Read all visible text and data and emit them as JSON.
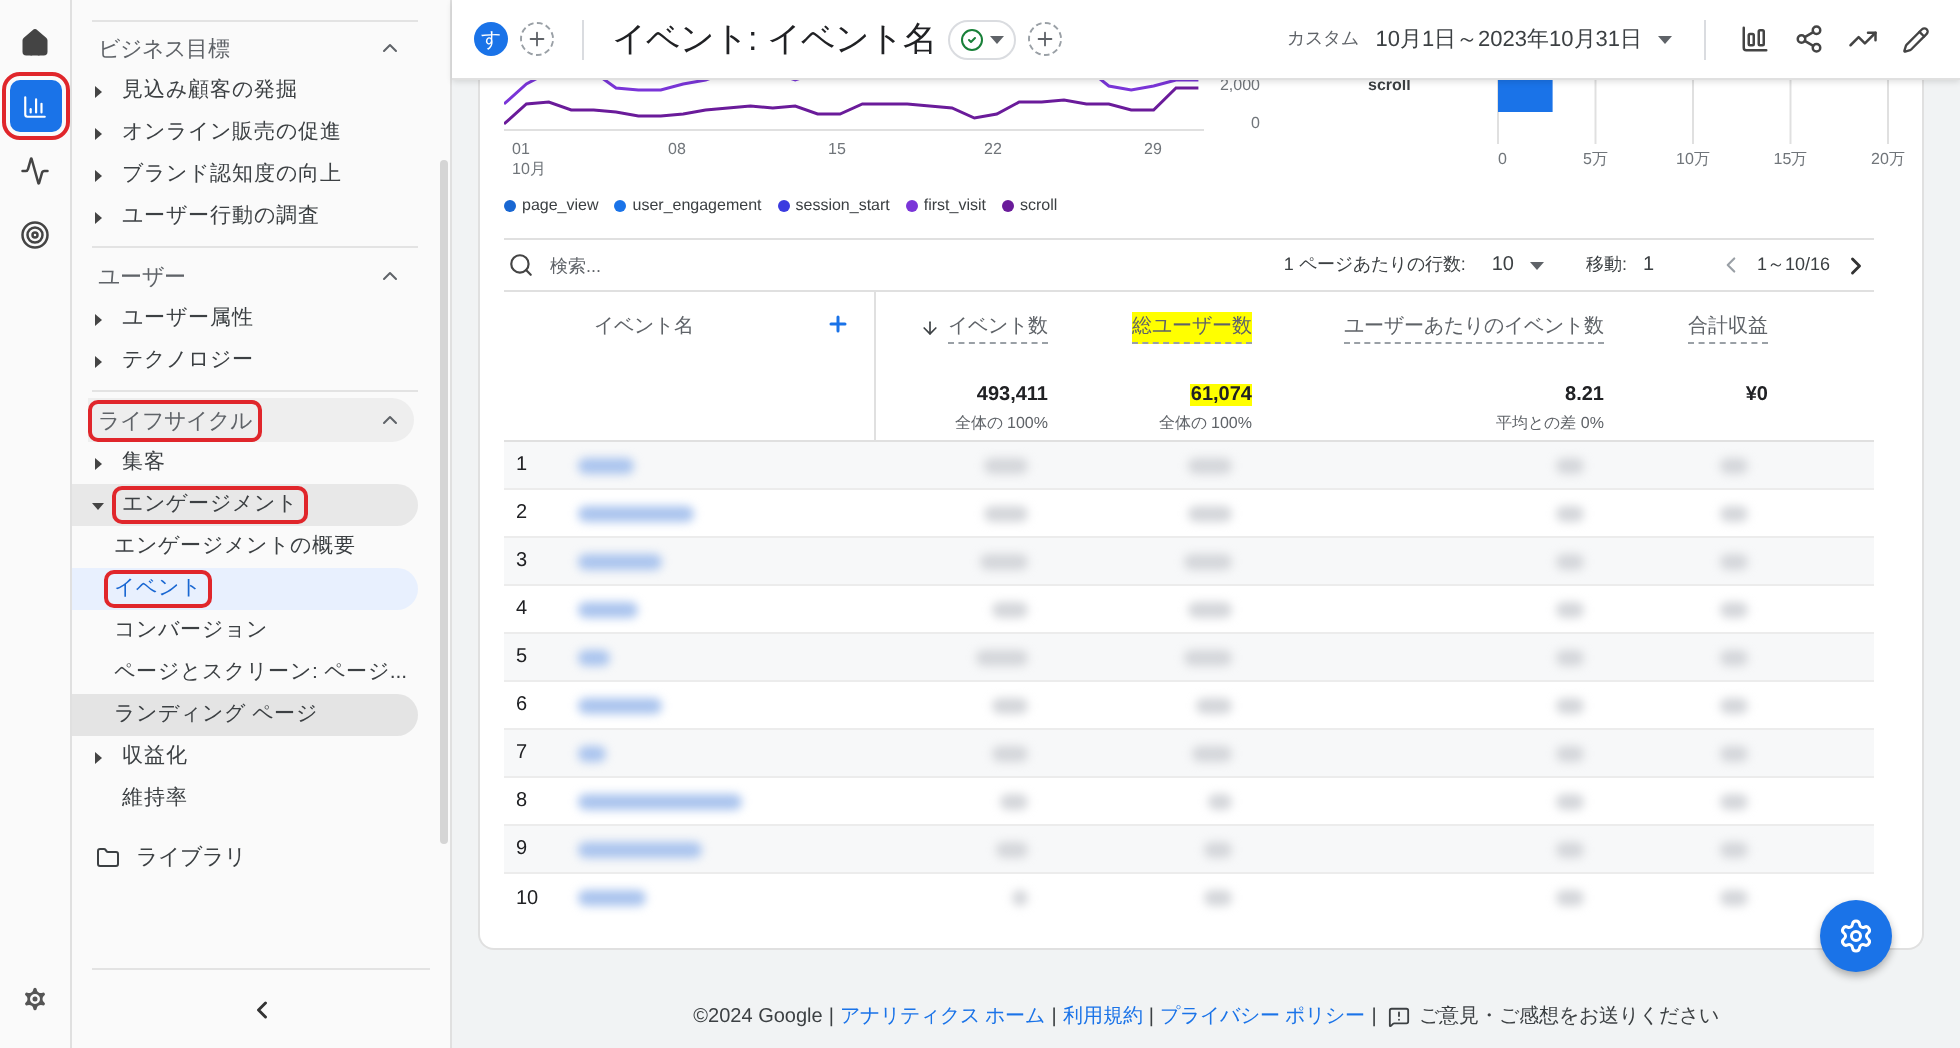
{
  "rail": {
    "items": [
      {
        "kind": "home",
        "selected": false,
        "annotated": false
      },
      {
        "kind": "reports",
        "selected": true,
        "annotated": true
      },
      {
        "kind": "explore",
        "selected": false,
        "annotated": false
      },
      {
        "kind": "advertising",
        "selected": false,
        "annotated": false
      }
    ],
    "settings": {
      "kind": "settings"
    }
  },
  "nav": {
    "sections": [
      {
        "title": "ビジネス目標",
        "expanded": true,
        "annotated": false,
        "hovered": false,
        "items": [
          {
            "label": "見込み顧客の発掘",
            "kind": "group",
            "expanded": false,
            "annotated": false
          },
          {
            "label": "オンライン販売の促進",
            "kind": "group",
            "expanded": false,
            "annotated": false
          },
          {
            "label": "ブランド認知度の向上",
            "kind": "group",
            "expanded": false,
            "annotated": false
          },
          {
            "label": "ユーザー行動の調査",
            "kind": "group",
            "expanded": false,
            "annotated": false
          }
        ]
      },
      {
        "title": "ユーザー",
        "expanded": true,
        "annotated": false,
        "hovered": false,
        "items": [
          {
            "label": "ユーザー属性",
            "kind": "group",
            "expanded": false,
            "annotated": false
          },
          {
            "label": "テクノロジー",
            "kind": "group",
            "expanded": false,
            "annotated": false
          }
        ]
      },
      {
        "title": "ライフサイクル",
        "expanded": true,
        "annotated": true,
        "hovered": true,
        "items": [
          {
            "label": "集客",
            "kind": "group",
            "expanded": false,
            "annotated": false
          },
          {
            "label": "エンゲージメント",
            "kind": "group",
            "expanded": true,
            "annotated": true,
            "children": [
              {
                "label": "エンゲージメントの概要",
                "selected": false,
                "annotated": false,
                "hovered": false
              },
              {
                "label": "イベント",
                "selected": true,
                "annotated": true,
                "hovered": false
              },
              {
                "label": "コンバージョン",
                "selected": false,
                "annotated": false,
                "hovered": false
              },
              {
                "label": "ページとスクリーン: ページ...",
                "selected": false,
                "annotated": false,
                "hovered": false
              },
              {
                "label": "ランディング ページ",
                "selected": false,
                "annotated": false,
                "hovered": true
              }
            ]
          },
          {
            "label": "収益化",
            "kind": "group",
            "expanded": false,
            "annotated": false
          },
          {
            "label": "維持率",
            "kind": "page",
            "expanded": false,
            "annotated": false
          }
        ]
      }
    ],
    "library": {
      "label": "ライブラリ"
    }
  },
  "topbar": {
    "avatar": "す",
    "title": "イベント: イベント名",
    "date_label": "カスタム",
    "date_range": "10月1日～2023年10月31日"
  },
  "line_chart": {
    "x_labels": [
      {
        "day": "01",
        "month": "10月"
      },
      {
        "day": "08"
      },
      {
        "day": "15"
      },
      {
        "day": "22"
      },
      {
        "day": "29"
      }
    ],
    "y_labels": [
      "2,000",
      "0"
    ],
    "legend": [
      {
        "name": "page_view",
        "color": "#1967d2"
      },
      {
        "name": "user_engagement",
        "color": "#1a73e8"
      },
      {
        "name": "session_start",
        "color": "#3b3be0"
      },
      {
        "name": "first_visit",
        "color": "#7a35d8"
      },
      {
        "name": "scroll",
        "color": "#6a1b9a"
      }
    ]
  },
  "bar_chart": {
    "chart_data": {
      "type": "bar",
      "orientation": "horizontal",
      "grid": true,
      "categories": [
        "scroll"
      ],
      "values": [
        2.8
      ],
      "xlim": [
        0,
        20
      ],
      "xticks": [
        {
          "value": 0,
          "label": "0"
        },
        {
          "value": 5,
          "label": "5万"
        },
        {
          "value": 10,
          "label": "10万"
        },
        {
          "value": 15,
          "label": "15万"
        },
        {
          "value": 20,
          "label": "20万"
        }
      ]
    }
  },
  "table": {
    "toolbar": {
      "search_placeholder": "検索...",
      "rows_per_page_label": "1 ページあたりの行数:",
      "rows_per_page": "10",
      "goto_label": "移動:",
      "goto_value": "1",
      "range": "1～10/16"
    },
    "columns": [
      {
        "label": "イベント名",
        "kind": "dimension",
        "highlighted": false
      },
      {
        "label": "イベント数",
        "kind": "metric",
        "sorted": true,
        "highlighted": false
      },
      {
        "label": "総ユーザー数",
        "kind": "metric",
        "sorted": false,
        "highlighted": true
      },
      {
        "label": "ユーザーあたりのイベント数",
        "kind": "metric",
        "sorted": false,
        "highlighted": false
      },
      {
        "label": "合計収益",
        "kind": "metric",
        "sorted": false,
        "highlighted": false
      }
    ],
    "totals": [
      {
        "value": "493,411",
        "note": "全体の 100%",
        "highlighted": false
      },
      {
        "value": "61,074",
        "note": "全体の 100%",
        "highlighted": true
      },
      {
        "value": "8.21",
        "note": "平均との差 0%",
        "highlighted": false
      },
      {
        "value": "¥0",
        "highlighted": false
      }
    ],
    "rows": [
      {
        "number": "1"
      },
      {
        "number": "2"
      },
      {
        "number": "3"
      },
      {
        "number": "4"
      },
      {
        "number": "5"
      },
      {
        "number": "6"
      },
      {
        "number": "7"
      },
      {
        "number": "8"
      },
      {
        "number": "9"
      },
      {
        "number": "10"
      }
    ]
  },
  "footer": {
    "copyright": "©2024 Google",
    "separator": "|",
    "links": [
      "アナリティクス ホーム",
      "利用規約",
      "プライバシー ポリシー"
    ],
    "feedback": "ご意見・ご感想をお送りください"
  }
}
